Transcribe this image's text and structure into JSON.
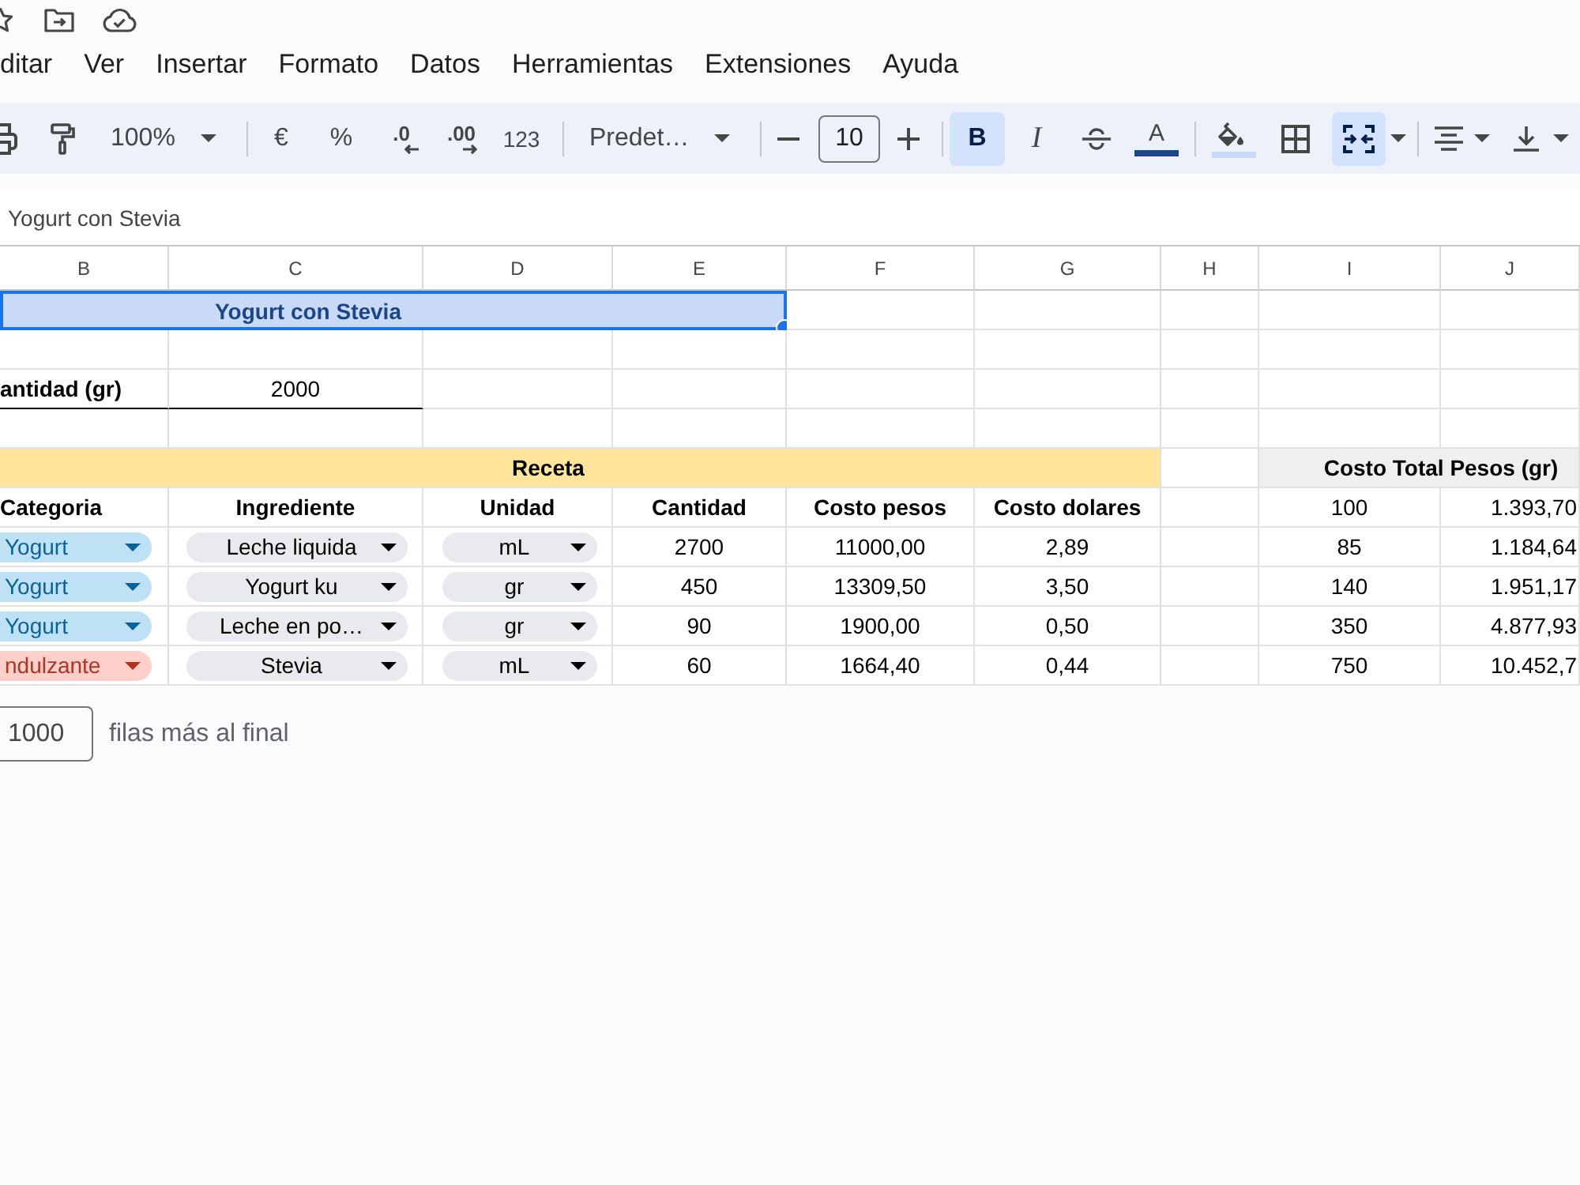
{
  "menu": [
    "ditar",
    "Ver",
    "Insertar",
    "Formato",
    "Datos",
    "Herramientas",
    "Extensiones",
    "Ayuda"
  ],
  "toolbar": {
    "zoom": "100%",
    "currency": "€",
    "percent": "%",
    "decrease_decimals": ".0",
    "increase_decimals": ".00",
    "number_format": "123",
    "font": "Predet…",
    "font_size": "10",
    "bold": {
      "label": "B",
      "selected": true
    },
    "italic": {
      "label": "I",
      "selected": false
    },
    "strikethrough": {
      "selected": false
    },
    "text_color": {
      "label": "A"
    },
    "merge": {
      "selected": true
    }
  },
  "formula_bar": {
    "value": "Yogurt con Stevia"
  },
  "sheet": {
    "column_letters": [
      "B",
      "C",
      "D",
      "E",
      "F",
      "G",
      "H",
      "I",
      "J"
    ],
    "title": {
      "text": "Yogurt con Stevia",
      "selected": true
    },
    "quantity": {
      "label": "antidad (gr)",
      "value": "2000"
    },
    "recipe": {
      "title": "Receta",
      "columns": [
        "Categoria",
        "Ingrediente",
        "Unidad",
        "Cantidad",
        "Costo pesos",
        "Costo dolares"
      ],
      "rows": [
        {
          "category": {
            "text": "Yogurt",
            "color": "#bfe1f6"
          },
          "ingredient": "Leche liquida",
          "unit": "mL",
          "quantity": "2700",
          "cost_pesos": "11000,00",
          "cost_dollars": "2,89"
        },
        {
          "category": {
            "text": "Yogurt",
            "color": "#bfe1f6"
          },
          "ingredient": "Yogurt ku",
          "unit": "gr",
          "quantity": "450",
          "cost_pesos": "13309,50",
          "cost_dollars": "3,50"
        },
        {
          "category": {
            "text": "Yogurt",
            "color": "#bfe1f6"
          },
          "ingredient": "Leche en po…",
          "unit": "gr",
          "quantity": "90",
          "cost_pesos": "1900,00",
          "cost_dollars": "0,50"
        },
        {
          "category": {
            "text": "ndulzante",
            "color": "#ffcfc9"
          },
          "ingredient": "Stevia",
          "unit": "mL",
          "quantity": "60",
          "cost_pesos": "1664,40",
          "cost_dollars": "0,44"
        }
      ]
    },
    "cost_total": {
      "title": "Costo Total Pesos (gr)",
      "rows": [
        [
          "100",
          "1.393,70"
        ],
        [
          "85",
          "1.184,64"
        ],
        [
          "140",
          "1.951,17"
        ],
        [
          "350",
          "4.877,93"
        ],
        [
          "750",
          "10.452,7"
        ]
      ]
    }
  },
  "add_rows": {
    "value": "1000",
    "label": "filas más al final"
  }
}
